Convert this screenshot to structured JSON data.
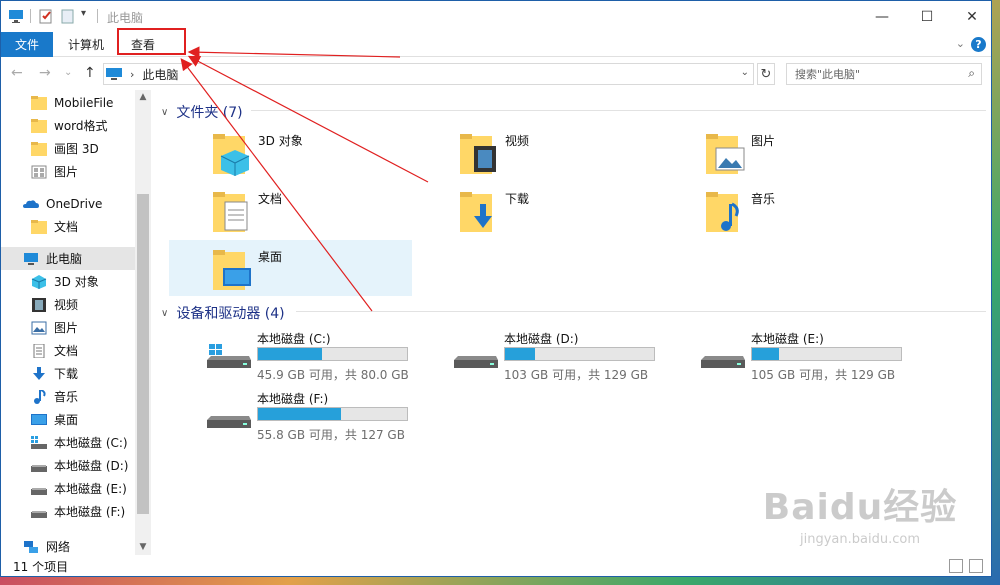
{
  "window": {
    "title": "此电脑",
    "controls": {
      "minimize": "—",
      "maximize": "☐",
      "close": "✕"
    }
  },
  "ribbon": {
    "tabs": [
      {
        "label": "文件"
      },
      {
        "label": "计算机"
      },
      {
        "label": "查看"
      }
    ],
    "expand_chevron": "⌄",
    "help": "?"
  },
  "nav": {
    "back": "←",
    "forward": "→",
    "recent": "⌄",
    "up": "↑",
    "path": "此电脑",
    "path_chevron": "›",
    "dropdown": "⌄",
    "refresh": "↻",
    "search_placeholder": "搜索\"此电脑\"",
    "search_icon": "⌕"
  },
  "sidebar": {
    "items": [
      {
        "label": "MobileFile",
        "icon": "folder-icon"
      },
      {
        "label": "word格式",
        "icon": "folder-icon"
      },
      {
        "label": "画图 3D",
        "icon": "folder-icon"
      },
      {
        "label": "图片",
        "icon": "pictures-icon"
      },
      {
        "label": "OneDrive",
        "icon": "onedrive-icon"
      },
      {
        "label": "文档",
        "icon": "folder-icon"
      },
      {
        "label": "此电脑",
        "icon": "this-pc-icon"
      },
      {
        "label": "3D 对象",
        "icon": "3d-objects-icon"
      },
      {
        "label": "视频",
        "icon": "video-icon"
      },
      {
        "label": "图片",
        "icon": "pictures-icon"
      },
      {
        "label": "文档",
        "icon": "documents-icon"
      },
      {
        "label": "下载",
        "icon": "download-icon"
      },
      {
        "label": "音乐",
        "icon": "music-icon"
      },
      {
        "label": "桌面",
        "icon": "desktop-icon"
      },
      {
        "label": "本地磁盘 (C:)",
        "icon": "drive-icon"
      },
      {
        "label": "本地磁盘 (D:)",
        "icon": "drive-icon"
      },
      {
        "label": "本地磁盘 (E:)",
        "icon": "drive-icon"
      },
      {
        "label": "本地磁盘 (F:)",
        "icon": "drive-icon"
      },
      {
        "label": "网络",
        "icon": "network-icon"
      }
    ],
    "scroll_up": "▲",
    "scroll_down": "▼"
  },
  "content": {
    "folders_header": "文件夹 (7)",
    "folders": [
      {
        "label": "3D 对象",
        "icon": "3d-objects-folder-icon"
      },
      {
        "label": "视频",
        "icon": "video-folder-icon"
      },
      {
        "label": "图片",
        "icon": "pictures-folder-icon"
      },
      {
        "label": "文档",
        "icon": "documents-folder-icon"
      },
      {
        "label": "下载",
        "icon": "download-folder-icon"
      },
      {
        "label": "音乐",
        "icon": "music-folder-icon"
      },
      {
        "label": "桌面",
        "icon": "desktop-folder-icon"
      }
    ],
    "drives_header": "设备和驱动器 (4)",
    "drives": [
      {
        "name": "本地磁盘 (C:)",
        "free": "45.9 GB 可用，共 80.0 GB",
        "used_fraction": 0.43
      },
      {
        "name": "本地磁盘 (D:)",
        "free": "103 GB 可用，共 129 GB",
        "used_fraction": 0.2
      },
      {
        "name": "本地磁盘 (E:)",
        "free": "105 GB 可用，共 129 GB",
        "used_fraction": 0.18
      },
      {
        "name": "本地磁盘 (F:)",
        "free": "55.8 GB 可用，共 127 GB",
        "used_fraction": 0.56
      }
    ]
  },
  "status": {
    "count": "11 个项目"
  },
  "watermark": {
    "brand": "Baidu经验",
    "url": "jingyan.baidu.com"
  },
  "colors": {
    "accent": "#1979ca",
    "annotation": "#e02020",
    "drive_fill": "#26a0da",
    "selection": "#e5f3fb"
  }
}
